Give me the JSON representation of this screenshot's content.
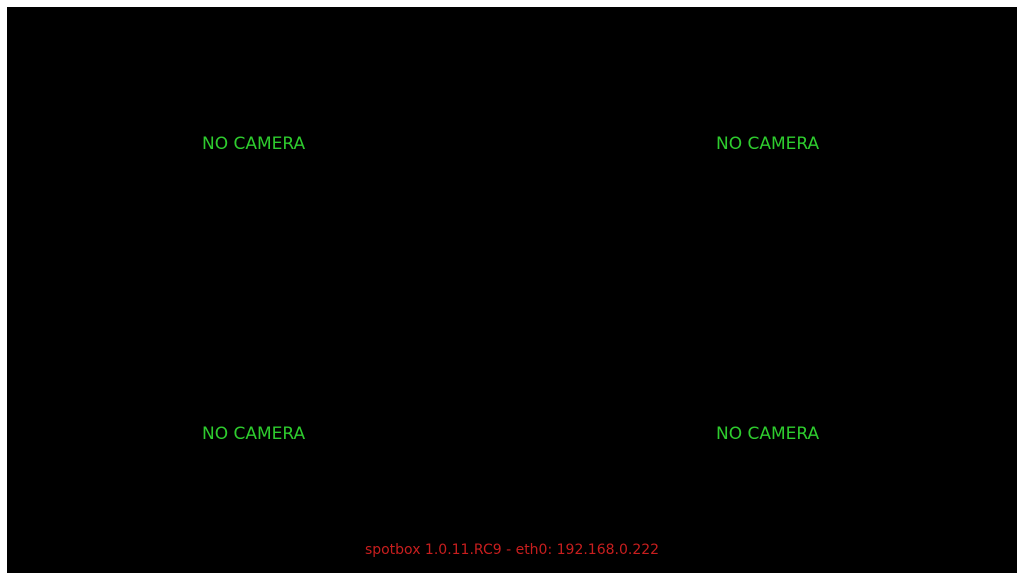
{
  "cameras": [
    {
      "label": "NO CAMERA"
    },
    {
      "label": "NO CAMERA"
    },
    {
      "label": "NO CAMERA"
    },
    {
      "label": "NO CAMERA"
    }
  ],
  "status_bar": {
    "text": "spotbox 1.0.11.RC9 - eth0: 192.168.0.222"
  },
  "colors": {
    "background": "#000000",
    "camera_label": "#2ecc2e",
    "status_text": "#c81e1e"
  }
}
